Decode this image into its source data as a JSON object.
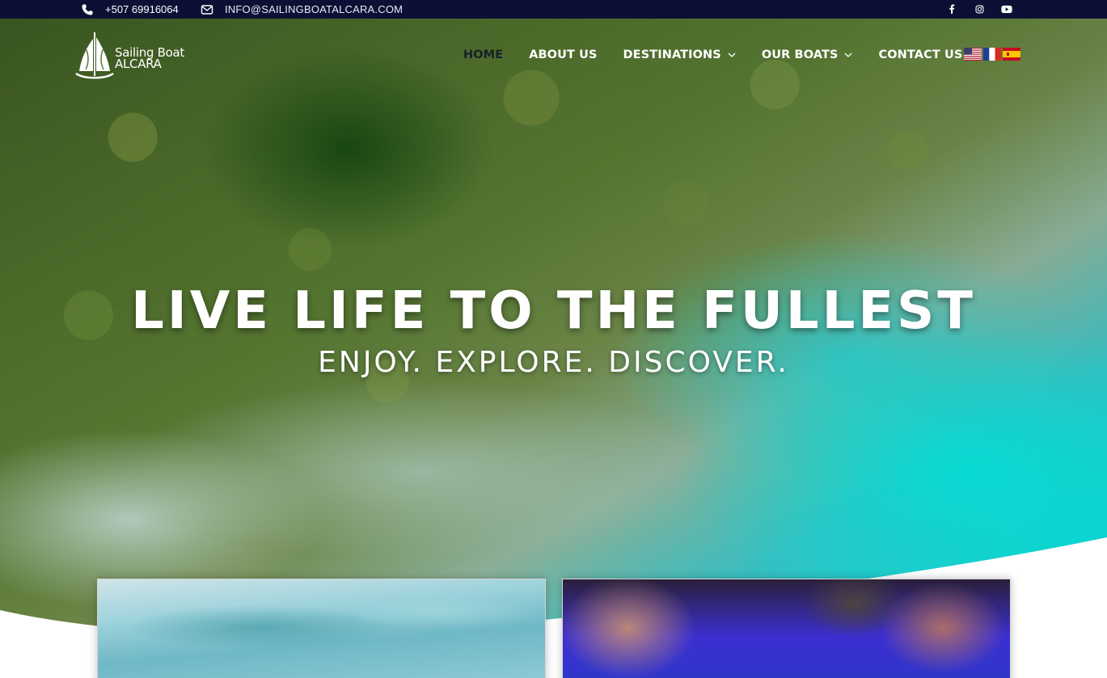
{
  "topbar": {
    "phone": "+507 69916064",
    "email": "INFO@SAILINGBOATALCARA.COM",
    "social": [
      "facebook-icon",
      "instagram-icon",
      "youtube-icon"
    ]
  },
  "brand": {
    "line1": "Sailing Boat",
    "line2": "ALCARA"
  },
  "nav": {
    "items": [
      {
        "label": "HOME",
        "active": true,
        "dropdown": false
      },
      {
        "label": "ABOUT US",
        "active": false,
        "dropdown": false
      },
      {
        "label": "DESTINATIONS",
        "active": false,
        "dropdown": true
      },
      {
        "label": "OUR BOATS",
        "active": false,
        "dropdown": true
      },
      {
        "label": "CONTACT US",
        "active": false,
        "dropdown": false
      }
    ],
    "languages": [
      "english-flag-icon",
      "french-flag-icon",
      "spanish-flag-icon"
    ]
  },
  "hero": {
    "title": "LIVE LIFE TO THE FULLEST",
    "subtitle": "ENJOY. EXPLORE. DISCOVER."
  },
  "colors": {
    "topbar_bg": "#0d1035",
    "nav_active": "#17202a",
    "text_light": "#ffffff"
  }
}
